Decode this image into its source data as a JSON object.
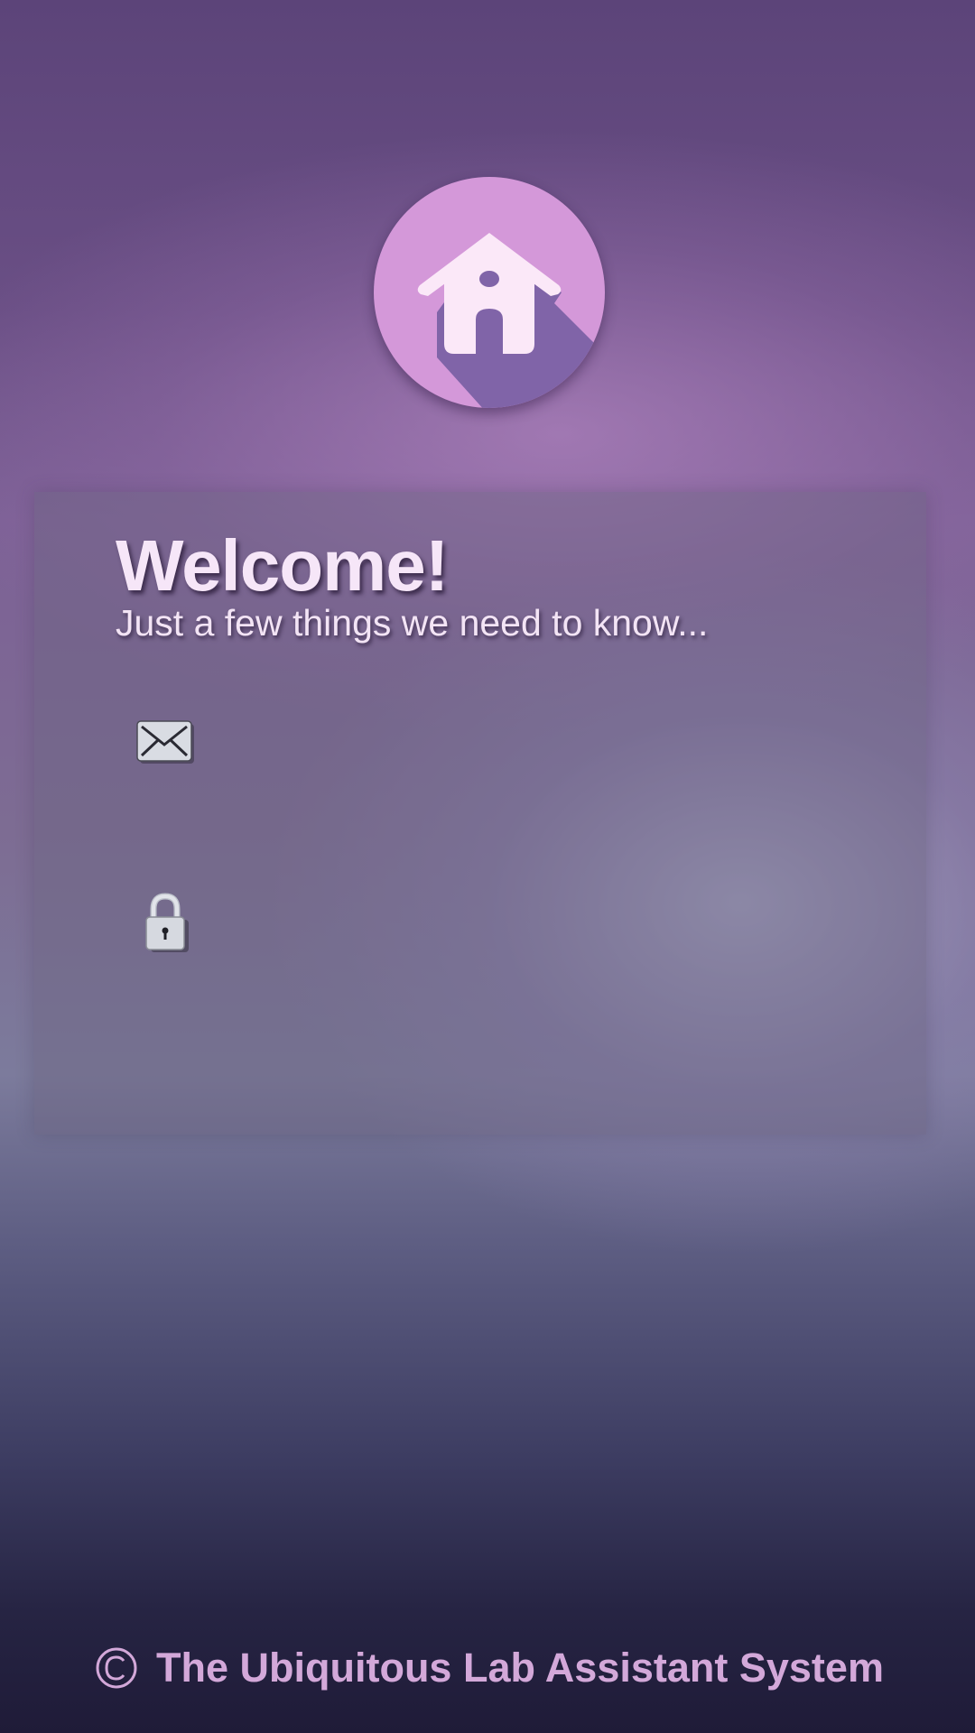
{
  "app": {
    "logo_icon": "home-icon",
    "logo_color": "#d498d9"
  },
  "login_card": {
    "title": "Welcome!",
    "subtitle": "Just a few things we need to know...",
    "email_field": {
      "icon": "envelope-icon",
      "value": "",
      "placeholder": ""
    },
    "password_field": {
      "icon": "lock-icon",
      "value": "",
      "placeholder": ""
    }
  },
  "footer": {
    "icon": "copyright-icon",
    "text": "The Ubiquitous Lab Assistant System"
  }
}
